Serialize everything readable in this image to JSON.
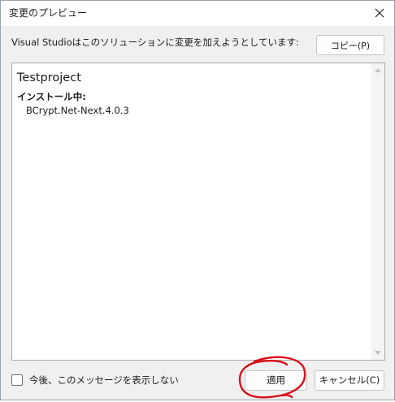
{
  "window": {
    "title": "変更のプレビュー",
    "close_icon": "close-icon"
  },
  "header": {
    "prompt": "Visual Studioはこのソリューションに変更を加えようとしています:",
    "copy_label": "コピー(P)"
  },
  "preview": {
    "project_name": "Testproject",
    "section_title": "インストール中:",
    "packages": [
      "BCrypt.Net-Next.4.0.3"
    ]
  },
  "footer": {
    "dont_show_label": "今後、このメッセージを表示しない",
    "dont_show_checked": false,
    "apply_label": "適用",
    "cancel_label": "キャンセル(C)"
  },
  "colors": {
    "dialog_background": "#f0f0f0",
    "annotation": "#d9111b"
  }
}
